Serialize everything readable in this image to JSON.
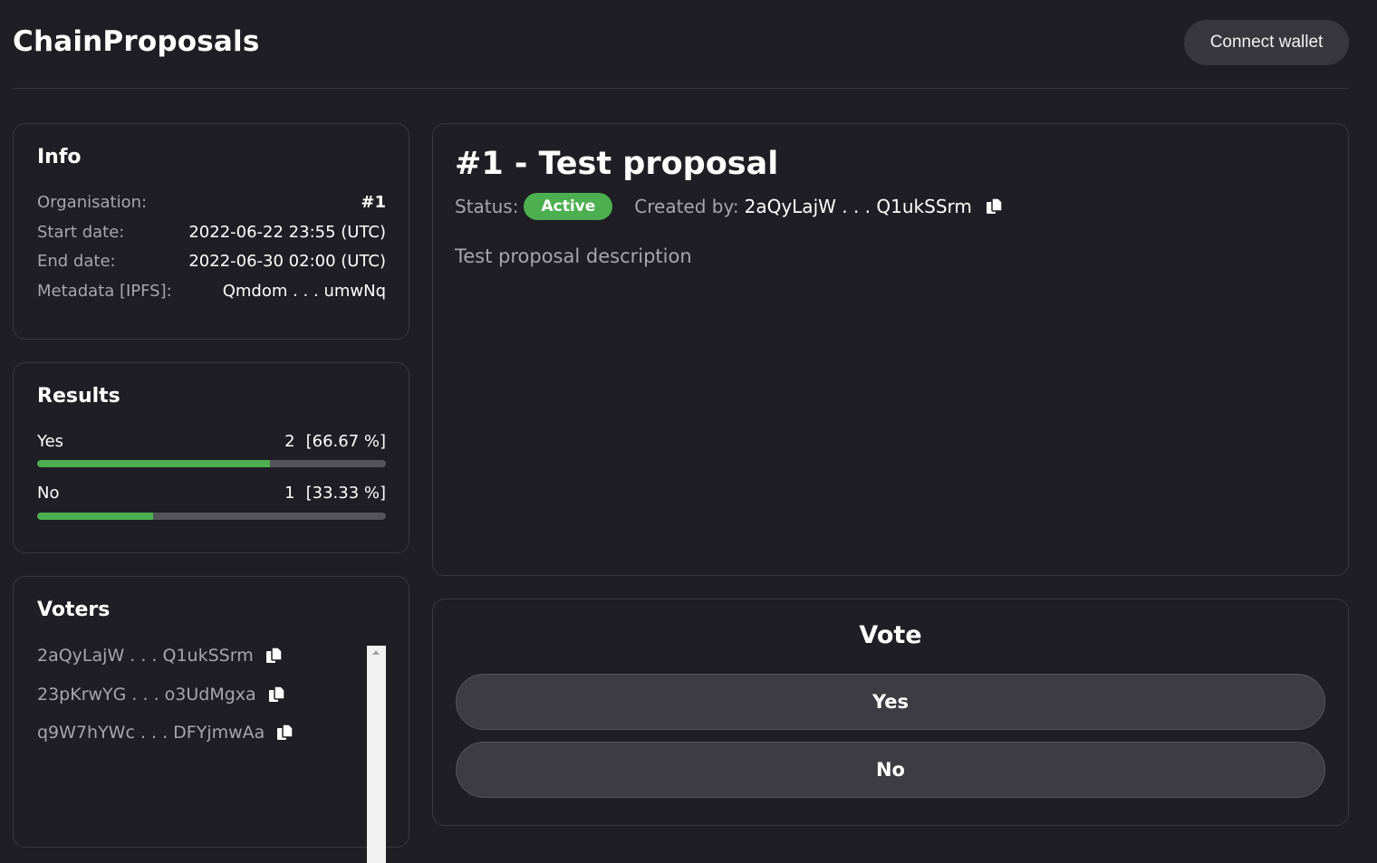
{
  "header": {
    "brand": "ChainProposals",
    "connect_label": "Connect wallet"
  },
  "info": {
    "title": "Info",
    "rows": [
      {
        "label": "Organisation:",
        "value": "#1"
      },
      {
        "label": "Start date:",
        "value": "2022-06-22 23:55 (UTC)"
      },
      {
        "label": "End date:",
        "value": "2022-06-30 02:00 (UTC)"
      },
      {
        "label": "Metadata [IPFS]:",
        "value": "Qmdom . . . umwNq"
      }
    ]
  },
  "results": {
    "title": "Results",
    "items": [
      {
        "label": "Yes",
        "count": "2",
        "percent": "[66.67 %]",
        "fraction": 0.6667
      },
      {
        "label": "No",
        "count": "1",
        "percent": "[33.33 %]",
        "fraction": 0.3333
      }
    ]
  },
  "voters": {
    "title": "Voters",
    "items": [
      "2aQyLajW . . . Q1ukSSrm",
      "23pKrwYG . . . o3UdMgxa",
      "q9W7hYWc . . . DFYjmwAa"
    ]
  },
  "proposal": {
    "title": "#1 - Test proposal",
    "status_label": "Status:",
    "status_value": "Active",
    "created_label": "Created by:",
    "created_value": "2aQyLajW . . . Q1ukSSrm",
    "description": "Test proposal description"
  },
  "vote": {
    "title": "Vote",
    "yes_label": "Yes",
    "no_label": "No"
  },
  "colors": {
    "background": "#1f1e24",
    "accent_green": "#4caf50",
    "muted_text": "#a7a6ad"
  },
  "icons": {
    "copy": "copy-icon"
  }
}
